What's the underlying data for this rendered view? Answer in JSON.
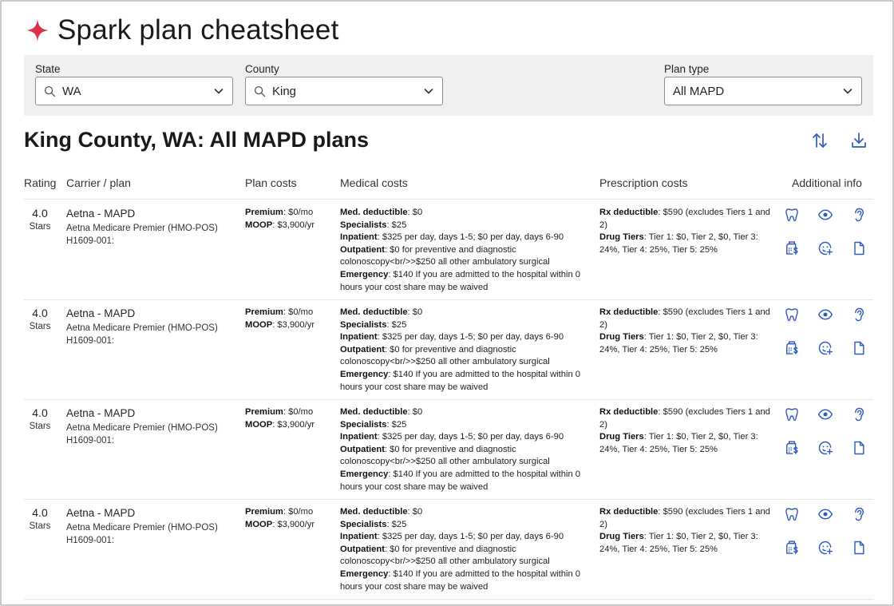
{
  "app": {
    "title": "Spark plan cheatsheet",
    "logo_icon": "sparkle-icon",
    "brand_color": "#d8334a",
    "icon_color": "#2f5bbd"
  },
  "filters": {
    "state": {
      "label": "State",
      "value": "WA"
    },
    "county": {
      "label": "County",
      "value": "King"
    },
    "plan_type": {
      "label": "Plan type",
      "value": "All MAPD"
    }
  },
  "results": {
    "title": "King County, WA: All MAPD plans",
    "sort_icon": "sort-icon",
    "download_icon": "download-icon"
  },
  "columns": {
    "rating": "Rating",
    "carrier": "Carrier / plan",
    "plan_costs": "Plan costs",
    "medical_costs": "Medical costs",
    "rx_costs": "Prescription costs",
    "additional": "Additional info"
  },
  "plans": [
    {
      "rating": "4.0",
      "rating_label": "Stars",
      "carrier": "Aetna - MAPD",
      "plan_name": "Aetna Medicare Premier (HMO-POS)",
      "plan_id": "H1609-001:",
      "premium_label": "Premium",
      "premium": ": $0/mo",
      "moop_label": "MOOP",
      "moop": ": $3,900/yr",
      "med_deductible_label": "Med. deductible",
      "med_deductible": ": $0",
      "specialists_label": "Specialists",
      "specialists": ": $25",
      "inpatient_label": "Inpatient",
      "inpatient": ": $325 per day, days 1-5; $0 per day, days 6-90",
      "outpatient_label": "Outpatient",
      "outpatient": ": $0 for preventive and diagnostic colonoscopy<br/>>$250 all other ambulatory surgical",
      "emergency_label": "Emergency",
      "emergency": ": $140 If you are admitted to the hospital within 0 hours your cost share may be waived",
      "rx_deductible_label": "Rx deductible",
      "rx_deductible": ": $590 (excludes Tiers 1 and 2)",
      "drug_tiers_label": "Drug Tiers",
      "drug_tiers": ": Tier 1: $0, Tier 2, $0, Tier 3: 24%, Tier 4: 25%, Tier 5: 25%"
    },
    {
      "rating": "4.0",
      "rating_label": "Stars",
      "carrier": "Aetna - MAPD",
      "plan_name": "Aetna Medicare Premier (HMO-POS)",
      "plan_id": "H1609-001:",
      "premium_label": "Premium",
      "premium": ": $0/mo",
      "moop_label": "MOOP",
      "moop": ": $3,900/yr",
      "med_deductible_label": "Med. deductible",
      "med_deductible": ": $0",
      "specialists_label": "Specialists",
      "specialists": ": $25",
      "inpatient_label": "Inpatient",
      "inpatient": ": $325 per day, days 1-5; $0 per day, days 6-90",
      "outpatient_label": "Outpatient",
      "outpatient": ": $0 for preventive and diagnostic colonoscopy<br/>>$250 all other ambulatory surgical",
      "emergency_label": "Emergency",
      "emergency": ": $140 If you are admitted to the hospital within 0 hours your cost share may be waived",
      "rx_deductible_label": "Rx deductible",
      "rx_deductible": ": $590 (excludes Tiers 1 and 2)",
      "drug_tiers_label": "Drug Tiers",
      "drug_tiers": ": Tier 1: $0, Tier 2, $0, Tier 3: 24%, Tier 4: 25%, Tier 5: 25%"
    },
    {
      "rating": "4.0",
      "rating_label": "Stars",
      "carrier": "Aetna - MAPD",
      "plan_name": "Aetna Medicare Premier (HMO-POS)",
      "plan_id": "H1609-001:",
      "premium_label": "Premium",
      "premium": ": $0/mo",
      "moop_label": "MOOP",
      "moop": ": $3,900/yr",
      "med_deductible_label": "Med. deductible",
      "med_deductible": ": $0",
      "specialists_label": "Specialists",
      "specialists": ": $25",
      "inpatient_label": "Inpatient",
      "inpatient": ": $325 per day, days 1-5; $0 per day, days 6-90",
      "outpatient_label": "Outpatient",
      "outpatient": ": $0 for preventive and diagnostic colonoscopy<br/>>$250 all other ambulatory surgical",
      "emergency_label": "Emergency",
      "emergency": ": $140 If you are admitted to the hospital within 0 hours your cost share may be waived",
      "rx_deductible_label": "Rx deductible",
      "rx_deductible": ": $590 (excludes Tiers 1 and 2)",
      "drug_tiers_label": "Drug Tiers",
      "drug_tiers": ": Tier 1: $0, Tier 2, $0, Tier 3: 24%, Tier 4: 25%, Tier 5: 25%"
    },
    {
      "rating": "4.0",
      "rating_label": "Stars",
      "carrier": "Aetna - MAPD",
      "plan_name": "Aetna Medicare Premier (HMO-POS)",
      "plan_id": "H1609-001:",
      "premium_label": "Premium",
      "premium": ": $0/mo",
      "moop_label": "MOOP",
      "moop": ": $3,900/yr",
      "med_deductible_label": "Med. deductible",
      "med_deductible": ": $0",
      "specialists_label": "Specialists",
      "specialists": ": $25",
      "inpatient_label": "Inpatient",
      "inpatient": ": $325 per day, days 1-5; $0 per day, days 6-90",
      "outpatient_label": "Outpatient",
      "outpatient": ": $0 for preventive and diagnostic colonoscopy<br/>>$250 all other ambulatory surgical",
      "emergency_label": "Emergency",
      "emergency": ": $140 If you are admitted to the hospital within 0 hours your cost share may be waived",
      "rx_deductible_label": "Rx deductible",
      "rx_deductible": ": $590 (excludes Tiers 1 and 2)",
      "drug_tiers_label": "Drug Tiers",
      "drug_tiers": ": Tier 1: $0, Tier 2, $0, Tier 3: 24%, Tier 4: 25%, Tier 5: 25%"
    }
  ],
  "additional_icons": [
    "tooth-icon",
    "eye-icon",
    "ear-icon",
    "pharmacy-cost-icon",
    "face-plus-icon",
    "document-icon"
  ]
}
